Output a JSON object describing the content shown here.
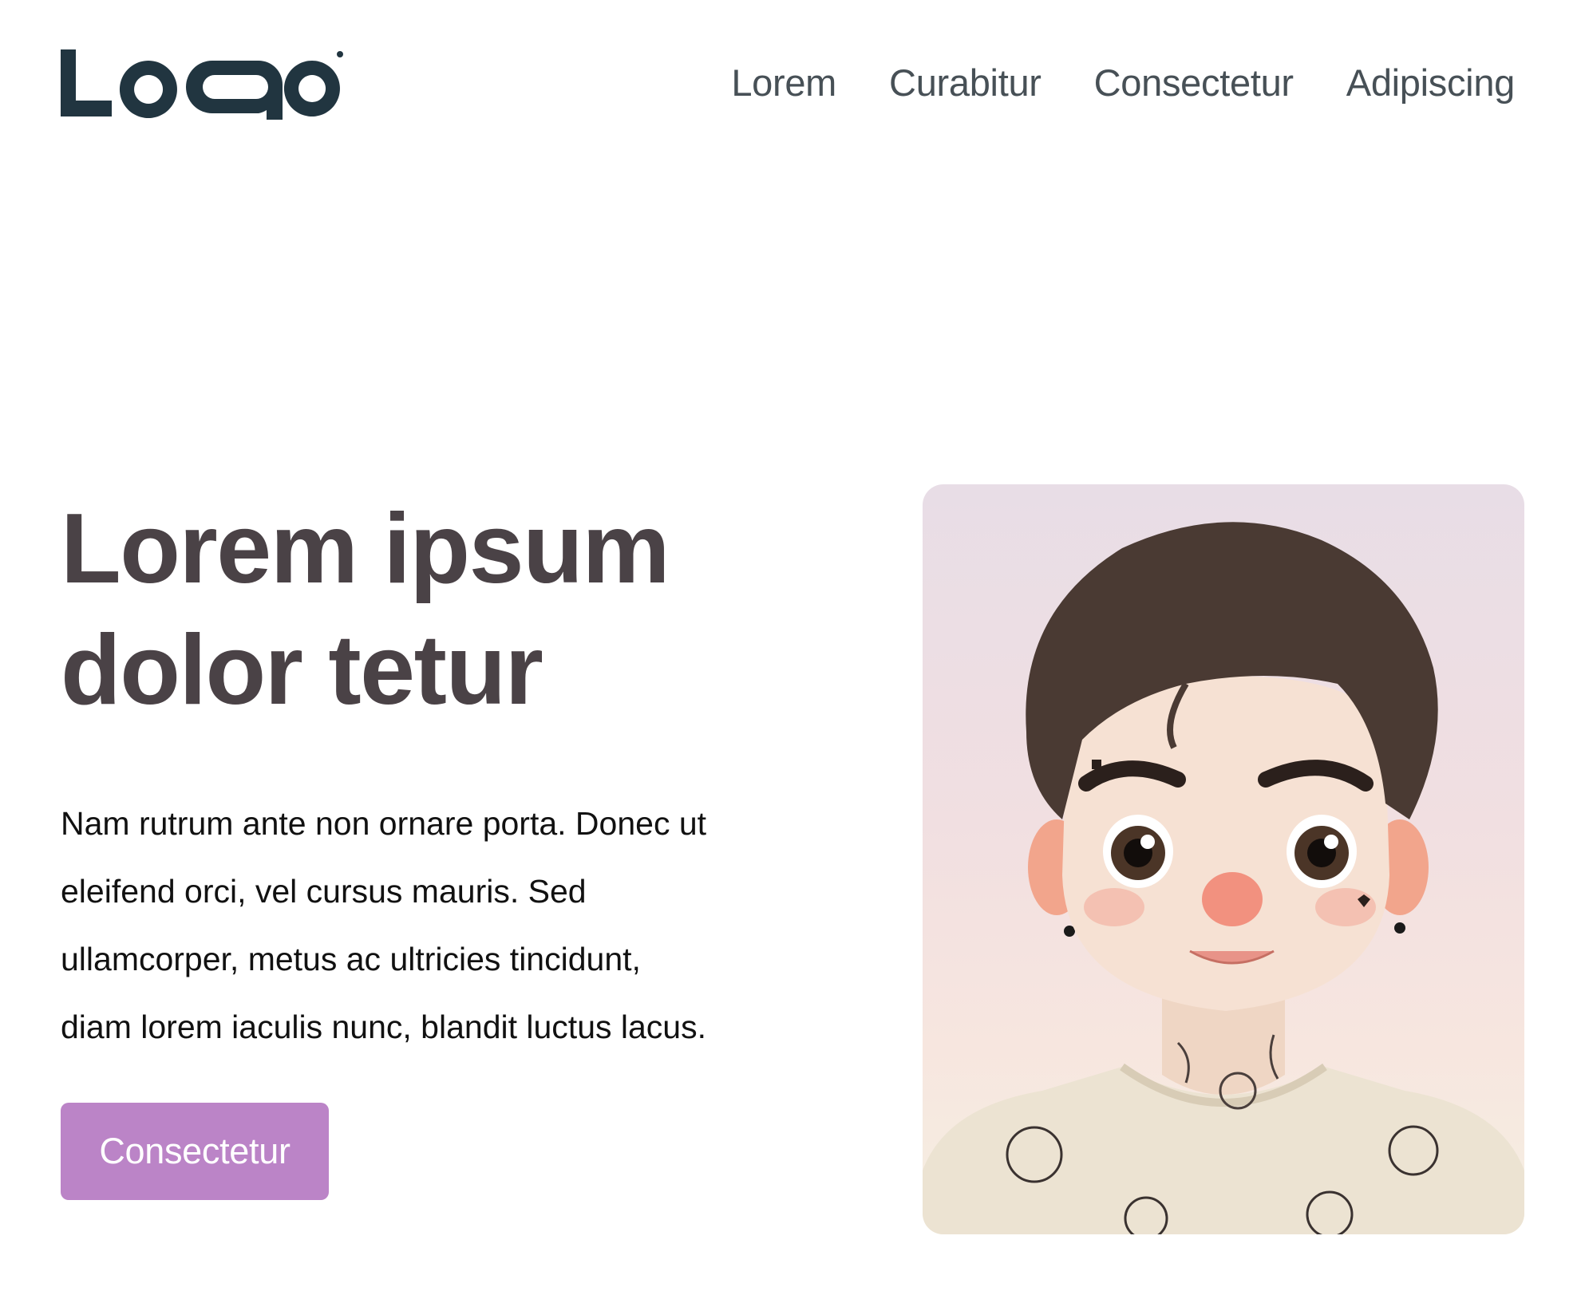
{
  "header": {
    "logo_text": "LOGO",
    "nav": [
      {
        "label": "Lorem"
      },
      {
        "label": "Curabitur"
      },
      {
        "label": "Consectetur"
      },
      {
        "label": "Adipiscing"
      }
    ]
  },
  "hero": {
    "title_lines": [
      "Lorem ipsum",
      "dolor tetur"
    ],
    "paragraph_lines": [
      "Nam rutrum ante non ornare porta. Donec ut",
      "eleifend orci, vel cursus mauris. Sed",
      "ullamcorper, metus ac ultricies tincidunt,",
      "diam lorem iaculis nunc, blandit luctus lacus."
    ],
    "cta_label": "Consectetur",
    "image_subject": "cartoon-portrait-tattooed-boy"
  },
  "colors": {
    "logo": "#213540",
    "nav_text": "#475056",
    "title": "#4a4246",
    "body_text": "#111111",
    "cta_background": "#bb84c7",
    "cta_text": "#ffffff"
  }
}
